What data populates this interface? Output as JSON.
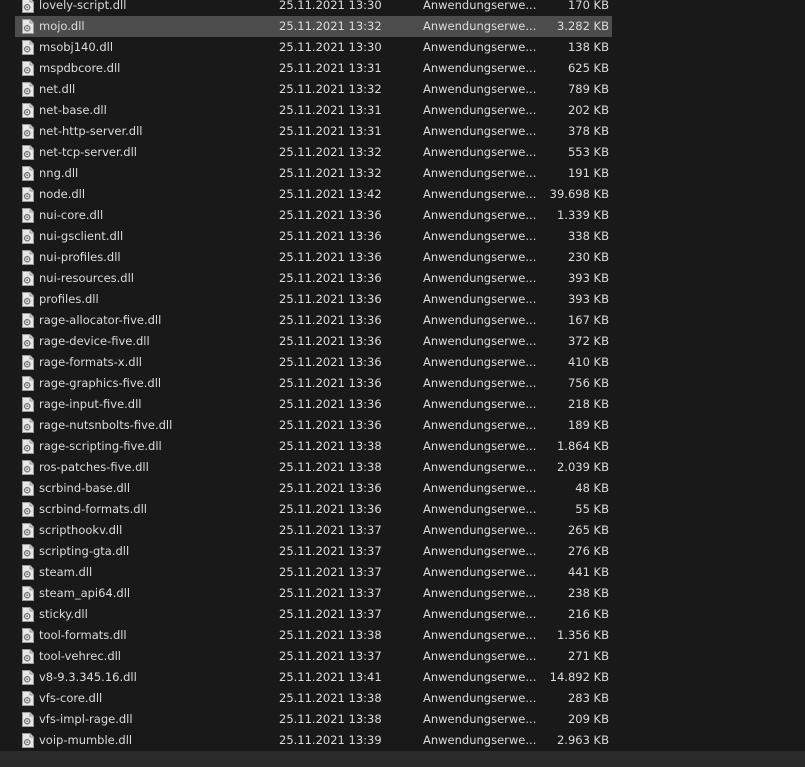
{
  "files": [
    {
      "name": "lovely-script.dll",
      "date": "25.11.2021 13:30",
      "type": "Anwendungserwe...",
      "size": "170 KB"
    },
    {
      "name": "mojo.dll",
      "date": "25.11.2021 13:32",
      "type": "Anwendungserwe...",
      "size": "3.282 KB",
      "selected": true
    },
    {
      "name": "msobj140.dll",
      "date": "25.11.2021 13:30",
      "type": "Anwendungserwe...",
      "size": "138 KB"
    },
    {
      "name": "mspdbcore.dll",
      "date": "25.11.2021 13:31",
      "type": "Anwendungserwe...",
      "size": "625 KB"
    },
    {
      "name": "net.dll",
      "date": "25.11.2021 13:32",
      "type": "Anwendungserwe...",
      "size": "789 KB"
    },
    {
      "name": "net-base.dll",
      "date": "25.11.2021 13:31",
      "type": "Anwendungserwe...",
      "size": "202 KB"
    },
    {
      "name": "net-http-server.dll",
      "date": "25.11.2021 13:31",
      "type": "Anwendungserwe...",
      "size": "378 KB"
    },
    {
      "name": "net-tcp-server.dll",
      "date": "25.11.2021 13:32",
      "type": "Anwendungserwe...",
      "size": "553 KB"
    },
    {
      "name": "nng.dll",
      "date": "25.11.2021 13:32",
      "type": "Anwendungserwe...",
      "size": "191 KB"
    },
    {
      "name": "node.dll",
      "date": "25.11.2021 13:42",
      "type": "Anwendungserwe...",
      "size": "39.698 KB"
    },
    {
      "name": "nui-core.dll",
      "date": "25.11.2021 13:36",
      "type": "Anwendungserwe...",
      "size": "1.339 KB"
    },
    {
      "name": "nui-gsclient.dll",
      "date": "25.11.2021 13:36",
      "type": "Anwendungserwe...",
      "size": "338 KB"
    },
    {
      "name": "nui-profiles.dll",
      "date": "25.11.2021 13:36",
      "type": "Anwendungserwe...",
      "size": "230 KB"
    },
    {
      "name": "nui-resources.dll",
      "date": "25.11.2021 13:36",
      "type": "Anwendungserwe...",
      "size": "393 KB"
    },
    {
      "name": "profiles.dll",
      "date": "25.11.2021 13:36",
      "type": "Anwendungserwe...",
      "size": "393 KB"
    },
    {
      "name": "rage-allocator-five.dll",
      "date": "25.11.2021 13:36",
      "type": "Anwendungserwe...",
      "size": "167 KB"
    },
    {
      "name": "rage-device-five.dll",
      "date": "25.11.2021 13:36",
      "type": "Anwendungserwe...",
      "size": "372 KB"
    },
    {
      "name": "rage-formats-x.dll",
      "date": "25.11.2021 13:36",
      "type": "Anwendungserwe...",
      "size": "410 KB"
    },
    {
      "name": "rage-graphics-five.dll",
      "date": "25.11.2021 13:36",
      "type": "Anwendungserwe...",
      "size": "756 KB"
    },
    {
      "name": "rage-input-five.dll",
      "date": "25.11.2021 13:36",
      "type": "Anwendungserwe...",
      "size": "218 KB"
    },
    {
      "name": "rage-nutsnbolts-five.dll",
      "date": "25.11.2021 13:36",
      "type": "Anwendungserwe...",
      "size": "189 KB"
    },
    {
      "name": "rage-scripting-five.dll",
      "date": "25.11.2021 13:38",
      "type": "Anwendungserwe...",
      "size": "1.864 KB"
    },
    {
      "name": "ros-patches-five.dll",
      "date": "25.11.2021 13:38",
      "type": "Anwendungserwe...",
      "size": "2.039 KB"
    },
    {
      "name": "scrbind-base.dll",
      "date": "25.11.2021 13:36",
      "type": "Anwendungserwe...",
      "size": "48 KB"
    },
    {
      "name": "scrbind-formats.dll",
      "date": "25.11.2021 13:36",
      "type": "Anwendungserwe...",
      "size": "55 KB"
    },
    {
      "name": "scripthookv.dll",
      "date": "25.11.2021 13:37",
      "type": "Anwendungserwe...",
      "size": "265 KB"
    },
    {
      "name": "scripting-gta.dll",
      "date": "25.11.2021 13:37",
      "type": "Anwendungserwe...",
      "size": "276 KB"
    },
    {
      "name": "steam.dll",
      "date": "25.11.2021 13:37",
      "type": "Anwendungserwe...",
      "size": "441 KB"
    },
    {
      "name": "steam_api64.dll",
      "date": "25.11.2021 13:37",
      "type": "Anwendungserwe...",
      "size": "238 KB"
    },
    {
      "name": "sticky.dll",
      "date": "25.11.2021 13:37",
      "type": "Anwendungserwe...",
      "size": "216 KB"
    },
    {
      "name": "tool-formats.dll",
      "date": "25.11.2021 13:38",
      "type": "Anwendungserwe...",
      "size": "1.356 KB"
    },
    {
      "name": "tool-vehrec.dll",
      "date": "25.11.2021 13:37",
      "type": "Anwendungserwe...",
      "size": "271 KB"
    },
    {
      "name": "v8-9.3.345.16.dll",
      "date": "25.11.2021 13:41",
      "type": "Anwendungserwe...",
      "size": "14.892 KB"
    },
    {
      "name": "vfs-core.dll",
      "date": "25.11.2021 13:38",
      "type": "Anwendungserwe...",
      "size": "283 KB"
    },
    {
      "name": "vfs-impl-rage.dll",
      "date": "25.11.2021 13:38",
      "type": "Anwendungserwe...",
      "size": "209 KB"
    },
    {
      "name": "voip-mumble.dll",
      "date": "25.11.2021 13:39",
      "type": "Anwendungserwe...",
      "size": "2.963 KB"
    }
  ],
  "icon": "dll-file-icon",
  "colors": {
    "background": "#191919",
    "selected_row": "#4d4d4d",
    "text": "#dcdcdc"
  }
}
